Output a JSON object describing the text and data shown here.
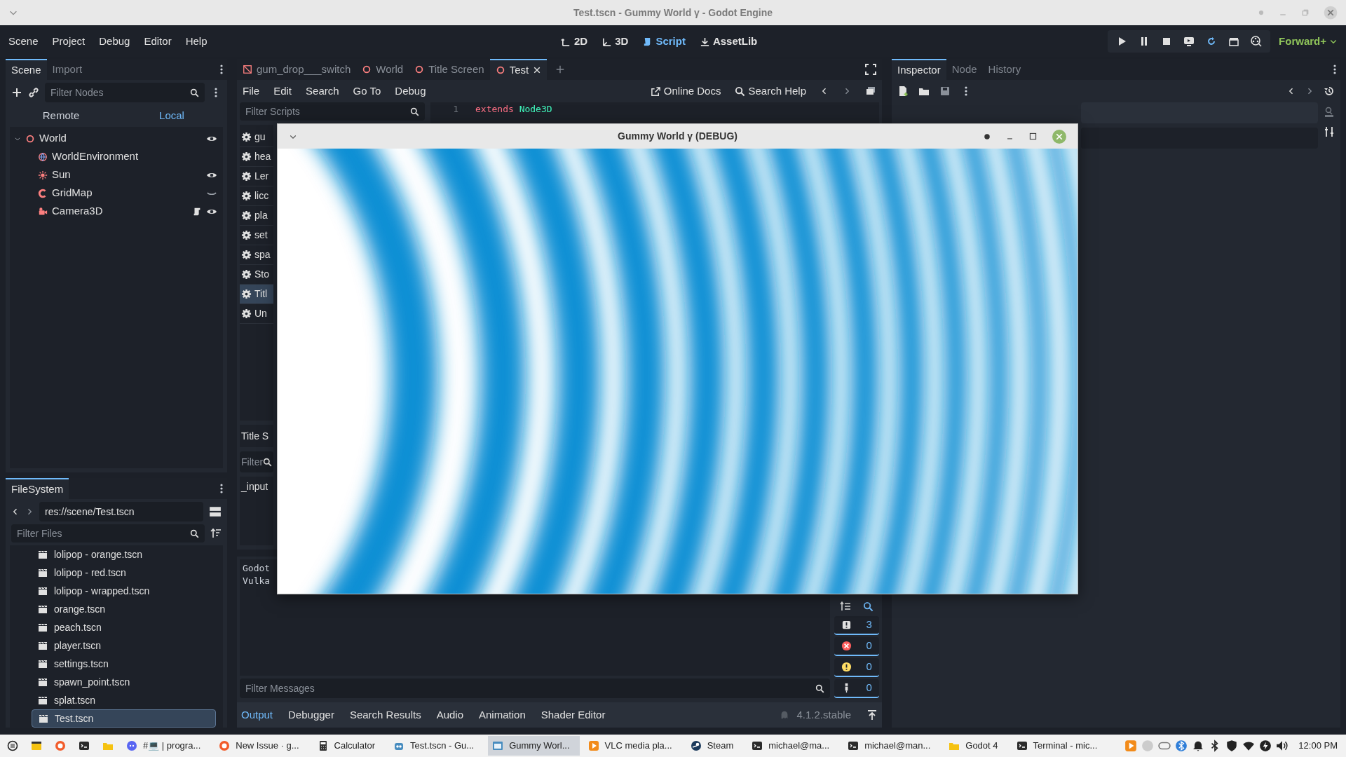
{
  "window": {
    "title": "Test.tscn - Gummy World γ - Godot Engine"
  },
  "menu": [
    "Scene",
    "Project",
    "Debug",
    "Editor",
    "Help"
  ],
  "workspaces": [
    {
      "label": "2D",
      "kind": "planar",
      "selected": false
    },
    {
      "label": "3D",
      "kind": "spatial",
      "selected": false
    },
    {
      "label": "Script",
      "kind": "script",
      "selected": true
    },
    {
      "label": "AssetLib",
      "kind": "assetlib",
      "selected": false
    }
  ],
  "renderer": "Forward+",
  "scene_dock": {
    "tabs": [
      {
        "label": "Scene",
        "selected": true
      },
      {
        "label": "Import",
        "selected": false
      }
    ],
    "filter": {
      "placeholder": "Filter Nodes"
    },
    "modes": [
      {
        "label": "Remote",
        "selected": false
      },
      {
        "label": "Local",
        "selected": true
      }
    ],
    "tree": [
      {
        "name": "World",
        "kind": "node3d",
        "visible": true,
        "expanded": true,
        "children": [
          {
            "name": "WorldEnvironment",
            "kind": "environment"
          },
          {
            "name": "Sun",
            "kind": "light",
            "visible": true
          },
          {
            "name": "GridMap",
            "kind": "gridmap",
            "visible": false
          },
          {
            "name": "Camera3D",
            "kind": "camera",
            "visible": true,
            "has_script": true
          }
        ]
      }
    ]
  },
  "filesystem": {
    "tabs": [
      {
        "label": "FileSystem",
        "selected": true
      }
    ],
    "path": "res://scene/Test.tscn",
    "filter": {
      "placeholder": "Filter Files"
    },
    "files": [
      {
        "name": "lolipop - orange.tscn",
        "selected": false
      },
      {
        "name": "lolipop - red.tscn",
        "selected": false
      },
      {
        "name": "lolipop - wrapped.tscn",
        "selected": false
      },
      {
        "name": "orange.tscn",
        "selected": false
      },
      {
        "name": "peach.tscn",
        "selected": false
      },
      {
        "name": "player.tscn",
        "selected": false
      },
      {
        "name": "settings.tscn",
        "selected": false
      },
      {
        "name": "spawn_point.tscn",
        "selected": false
      },
      {
        "name": "splat.tscn",
        "selected": false
      },
      {
        "name": "Test.tscn",
        "selected": true
      }
    ]
  },
  "editor_tabs": [
    {
      "label": "gum_drop___switch",
      "kind": "canvas",
      "selected": false
    },
    {
      "label": "World",
      "kind": "spatial",
      "selected": false
    },
    {
      "label": "Title Screen",
      "kind": "spatial",
      "selected": false
    },
    {
      "label": "Test",
      "kind": "spatial",
      "selected": true
    }
  ],
  "script_editor": {
    "menu": [
      "File",
      "Edit",
      "Search",
      "Go To",
      "Debug"
    ],
    "online_docs": "Online Docs",
    "search_help": "Search Help",
    "scripts_filter": {
      "placeholder": "Filter Scripts"
    },
    "scripts": [
      {
        "name": "gu",
        "selected": false
      },
      {
        "name": "hea",
        "selected": false
      },
      {
        "name": "Ler",
        "selected": false
      },
      {
        "name": "licc",
        "selected": false
      },
      {
        "name": "pla",
        "selected": false
      },
      {
        "name": "set",
        "selected": false
      },
      {
        "name": "spa",
        "selected": false
      },
      {
        "name": "Sto",
        "selected": false
      },
      {
        "name": "Titl",
        "selected": true
      },
      {
        "name": "Un",
        "selected": false
      }
    ],
    "current_script": "Title S",
    "methods_filter": {
      "placeholder": "Filter"
    },
    "methods": [
      "_input"
    ],
    "code": [
      {
        "number": "1",
        "keyword": "extends",
        "type": "Node3D"
      }
    ]
  },
  "output": {
    "lines": [
      "Godot",
      "Vulka"
    ],
    "filter": {
      "placeholder": "Filter Messages"
    },
    "counters": [
      {
        "kind": "message",
        "count": "3",
        "on": true
      },
      {
        "kind": "error",
        "count": "0",
        "on": true
      },
      {
        "kind": "warning",
        "count": "0",
        "on": true
      },
      {
        "kind": "editor",
        "count": "0",
        "on": true
      }
    ],
    "tabs": [
      {
        "label": "Output",
        "selected": true
      },
      {
        "label": "Debugger",
        "selected": false
      },
      {
        "label": "Search Results",
        "selected": false
      },
      {
        "label": "Audio",
        "selected": false
      },
      {
        "label": "Animation",
        "selected": false
      },
      {
        "label": "Shader Editor",
        "selected": false
      }
    ],
    "version": "4.1.2.stable"
  },
  "inspector": {
    "tabs": [
      {
        "label": "Inspector",
        "selected": true
      },
      {
        "label": "Node",
        "selected": false
      },
      {
        "label": "History",
        "selected": false
      }
    ]
  },
  "game_window": {
    "title": "Gummy World γ (DEBUG)"
  },
  "taskbar": {
    "apps": [
      {
        "kind": "menu",
        "selected": false
      },
      {
        "kind": "files",
        "selected": false
      },
      {
        "kind": "browser",
        "selected": false
      },
      {
        "kind": "terminal",
        "selected": false
      },
      {
        "kind": "folder",
        "selected": false
      },
      {
        "kind": "chat",
        "label": "#💻 | progra...",
        "selected": false
      },
      {
        "kind": "browser",
        "label": "New Issue · g...",
        "selected": false
      },
      {
        "kind": "calculator",
        "label": "Calculator",
        "selected": false
      },
      {
        "kind": "godot",
        "label": "Test.tscn - Gu...",
        "selected": false
      },
      {
        "kind": "game",
        "label": "Gummy Worl...",
        "selected": true
      },
      {
        "kind": "media",
        "label": "VLC media pla...",
        "selected": false
      },
      {
        "kind": "steam",
        "label": "Steam",
        "selected": false
      },
      {
        "kind": "terminal",
        "label": "michael@ma...",
        "selected": false
      },
      {
        "kind": "terminal",
        "label": "michael@man...",
        "selected": false
      },
      {
        "kind": "folder",
        "label": "Godot 4",
        "selected": false
      },
      {
        "kind": "terminal",
        "label": "Terminal - mic...",
        "selected": false
      }
    ],
    "clock": "12:00 PM"
  }
}
